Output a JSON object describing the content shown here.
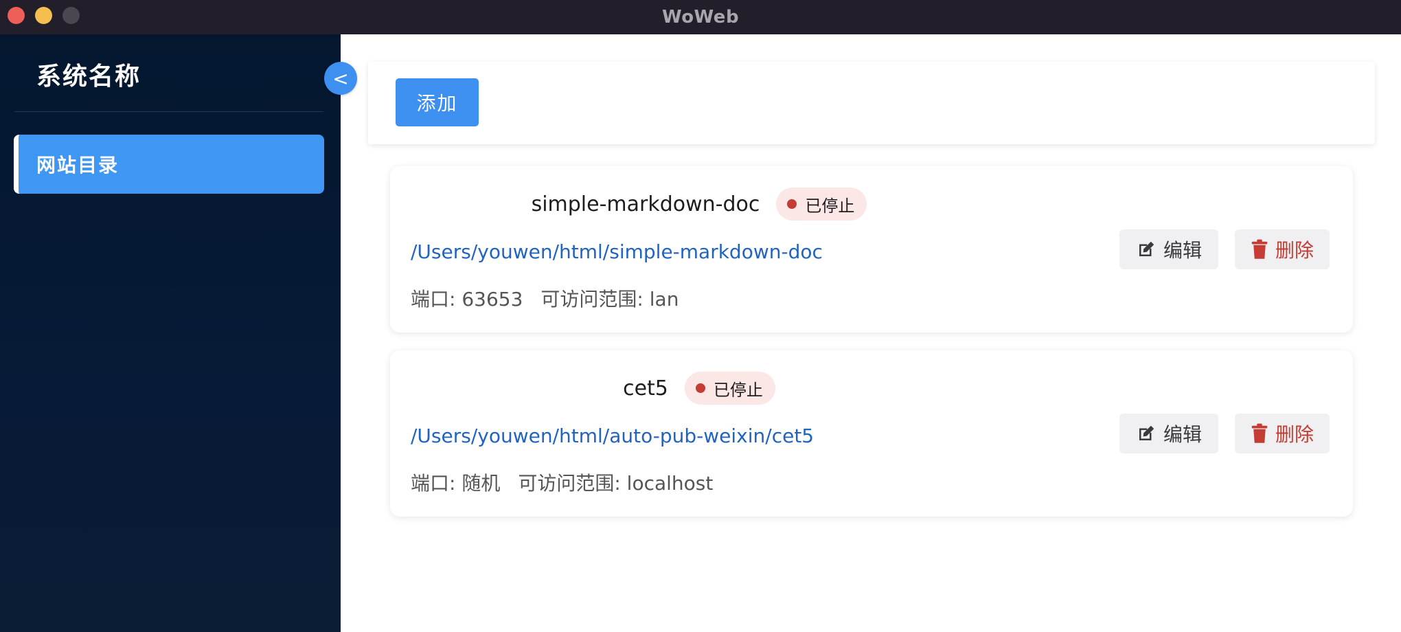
{
  "window": {
    "title": "WoWeb"
  },
  "sidebar": {
    "brand": "系统名称",
    "collapse_label": "<",
    "items": [
      {
        "label": "网站目录",
        "active": true
      }
    ]
  },
  "toolbar": {
    "add_label": "添加"
  },
  "sites": [
    {
      "name": "simple-markdown-doc",
      "status": "已停止",
      "path": "/Users/youwen/html/simple-markdown-doc",
      "port": "端口: 63653",
      "access": "可访问范围: lan",
      "edit_label": "编辑",
      "delete_label": "删除"
    },
    {
      "name": "cet5",
      "status": "已停止",
      "path": "/Users/youwen/html/auto-pub-weixin/cet5",
      "port": "端口: 随机",
      "access": "可访问范围: localhost",
      "edit_label": "编辑",
      "delete_label": "删除"
    }
  ],
  "colors": {
    "sidebar_bg": "#04172f",
    "accent": "#3d8ff0",
    "status_stopped": "#c43c33",
    "link": "#2163c3",
    "danger": "#c43c33"
  },
  "icons": {
    "edit": "edit-icon",
    "delete": "trash-icon",
    "status": "status-dot-icon"
  }
}
